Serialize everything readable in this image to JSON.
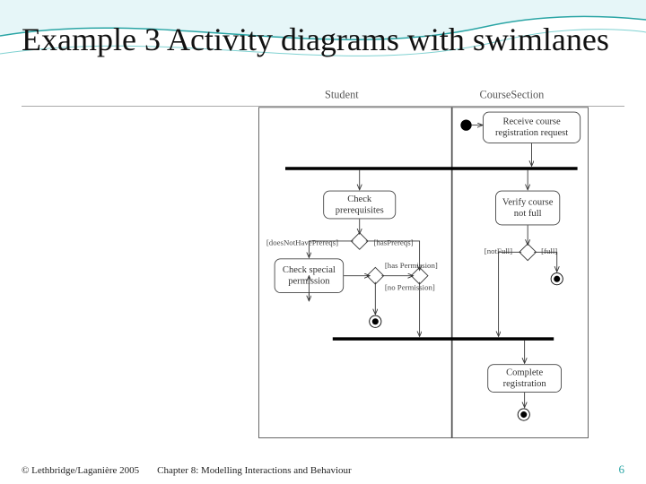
{
  "slide": {
    "title": "Example 3 Activity diagrams with swimlanes",
    "page_number": "6"
  },
  "footer": {
    "copyright": "© Lethbridge/Laganière 2005",
    "chapter": "Chapter 8: Modelling Interactions and Behaviour"
  },
  "diagram": {
    "lanes": {
      "student": "Student",
      "course_section": "CourseSection"
    },
    "activities": {
      "receive": "Receive course registration request",
      "check_prereq": "Check prerequisites",
      "verify_not_full": "Verify course not full",
      "check_special": "Check special permission",
      "complete": "Complete registration"
    },
    "guards": {
      "no_prereqs": "[doesNotHavePrereqs]",
      "has_prereqs": "[hasPrereqs]",
      "has_permission": "[has Permission]",
      "no_permission": "[no Permission]",
      "not_full": "[notFull]",
      "full": "[full]"
    }
  }
}
